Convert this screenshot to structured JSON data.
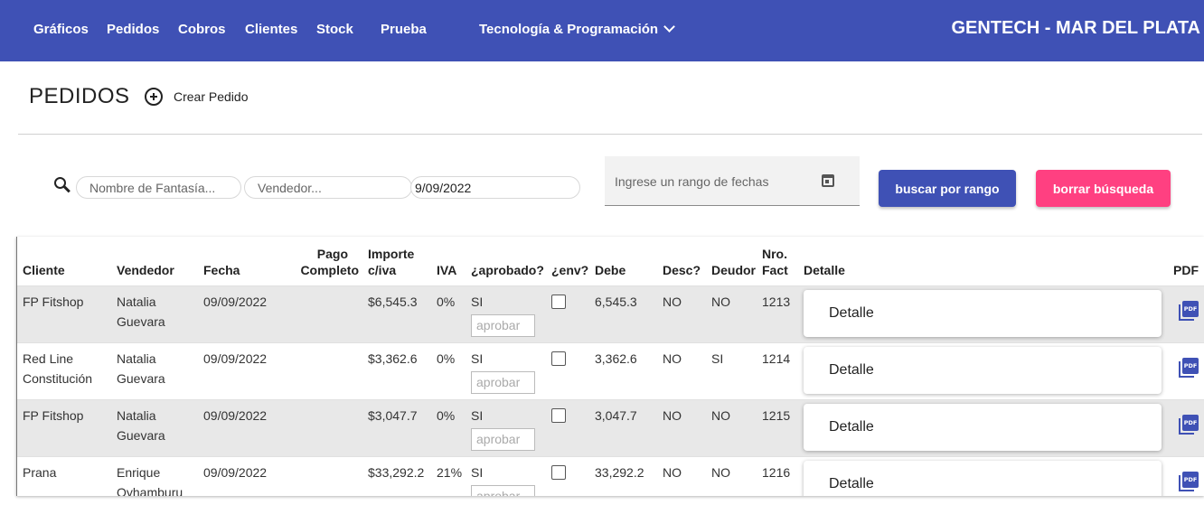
{
  "nav": {
    "items": [
      {
        "label": "Gráficos"
      },
      {
        "label": "Pedidos"
      },
      {
        "label": "Cobros"
      },
      {
        "label": "Clientes"
      },
      {
        "label": "Stock"
      },
      {
        "label": "Prueba"
      }
    ],
    "dropdown_label": "Tecnología & Programación",
    "dropdown_icon": "chevron-down-icon",
    "brand": "GENTECH - MAR DEL PLATA"
  },
  "header": {
    "title": "PEDIDOS",
    "create_label": "Crear Pedido",
    "create_icon": "add-circle-icon"
  },
  "filters": {
    "search_icon": "search-icon",
    "fantasy_placeholder": "Nombre de Fantasía...",
    "seller_placeholder": "Vendedor...",
    "date_value": "9/09/2022",
    "range_placeholder": "Ingrese un rango de fechas",
    "calendar_icon": "calendar-icon",
    "search_range_label": "buscar por rango",
    "clear_label": "borrar búsqueda"
  },
  "colors": {
    "primary": "#3f51b5",
    "accent": "#ff4081",
    "row_shade": "#e8e8e8"
  },
  "table": {
    "columns": {
      "cliente": "Cliente",
      "vendedor": "Vendedor",
      "fecha": "Fecha",
      "pago_l1": "Pago",
      "pago_l2": "Completo",
      "importe_l1": "Importe",
      "importe_l2": "c/iva",
      "iva": "IVA",
      "aprobado": "¿aprobado?",
      "env": "¿env?",
      "debe": "Debe",
      "desc": "Desc?",
      "deudor": "Deudor",
      "nro_l1": "Nro.",
      "nro_l2": "Fact",
      "detalle": "Detalle",
      "pdf": "PDF"
    },
    "rows": [
      {
        "cliente": "FP Fitshop",
        "vendedor": "Natalia Guevara",
        "fecha": "09/09/2022",
        "pago": "",
        "importe": "$6,545.3",
        "iva": "0%",
        "aprobado": "SI",
        "aprobar_label": "aprobar",
        "debe": "6,545.3",
        "desc": "NO",
        "deudor": "NO",
        "nro": "1213",
        "detalle_label": "Detalle",
        "pdf_label": "PDF"
      },
      {
        "cliente": "Red Line Constitución",
        "vendedor": "Natalia Guevara",
        "fecha": "09/09/2022",
        "pago": "",
        "importe": "$3,362.6",
        "iva": "0%",
        "aprobado": "SI",
        "aprobar_label": "aprobar",
        "debe": "3,362.6",
        "desc": "NO",
        "deudor": "SI",
        "nro": "1214",
        "detalle_label": "Detalle",
        "pdf_label": "PDF"
      },
      {
        "cliente": "FP Fitshop",
        "vendedor": "Natalia Guevara",
        "fecha": "09/09/2022",
        "pago": "",
        "importe": "$3,047.7",
        "iva": "0%",
        "aprobado": "SI",
        "aprobar_label": "aprobar",
        "debe": "3,047.7",
        "desc": "NO",
        "deudor": "NO",
        "nro": "1215",
        "detalle_label": "Detalle",
        "pdf_label": "PDF"
      },
      {
        "cliente": "Prana",
        "vendedor": "Enrique Oyhamburu",
        "fecha": "09/09/2022",
        "pago": "",
        "importe": "$33,292.2",
        "iva": "21%",
        "aprobado": "SI",
        "aprobar_label": "aprobar",
        "debe": "33,292.2",
        "desc": "NO",
        "deudor": "NO",
        "nro": "1216",
        "detalle_label": "Detalle",
        "pdf_label": "PDF"
      }
    ]
  }
}
